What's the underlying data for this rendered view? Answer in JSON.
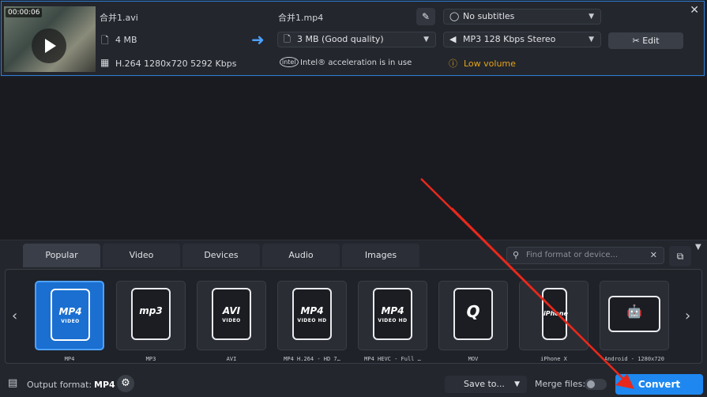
{
  "file": {
    "thumbnail_time": "00:00:06",
    "source_name": "合并1.avi",
    "source_size": "4 MB",
    "source_info": "H.264 1280x720 5292 Kbps",
    "output_name": "合并1.mp4",
    "output_size": "3 MB (Good quality)",
    "acceleration": "Intel® acceleration is in use",
    "subtitles": "No subtitles",
    "audio": "MP3 128 Kbps Stereo",
    "warning": "Low volume",
    "edit_label": "Edit",
    "close_glyph": "✕"
  },
  "tabs": [
    "Popular",
    "Video",
    "Devices",
    "Audio",
    "Images"
  ],
  "active_tab": "Popular",
  "search": {
    "placeholder": "Find format or device..."
  },
  "formats": [
    {
      "badge": "MP4",
      "sub": "VIDEO",
      "caption": "MP4"
    },
    {
      "badge": "mp3",
      "sub": "",
      "caption": "MP3"
    },
    {
      "badge": "AVI",
      "sub": "VIDEO",
      "caption": "AVI"
    },
    {
      "badge": "MP4",
      "sub": "VIDEO HD",
      "caption": "MP4 H.264 - HD 7…"
    },
    {
      "badge": "MP4",
      "sub": "VIDEO HD",
      "caption": "MP4 HEVC - Full …"
    },
    {
      "badge": "Q",
      "sub": "",
      "caption": "MOV"
    },
    {
      "badge": "iPhone",
      "sub": "",
      "caption": "iPhone X"
    },
    {
      "badge": "🤖",
      "sub": "",
      "caption": "Android - 1280x720"
    }
  ],
  "selected_format": "MP4",
  "footer": {
    "output_label": "Output format:",
    "output_value": "MP4",
    "save_to": "Save to...",
    "merge_label": "Merge files:",
    "convert_label": "Convert"
  },
  "colors": {
    "accent": "#1e88f0",
    "warning": "#e6a417",
    "annotation": "#e8281c"
  }
}
